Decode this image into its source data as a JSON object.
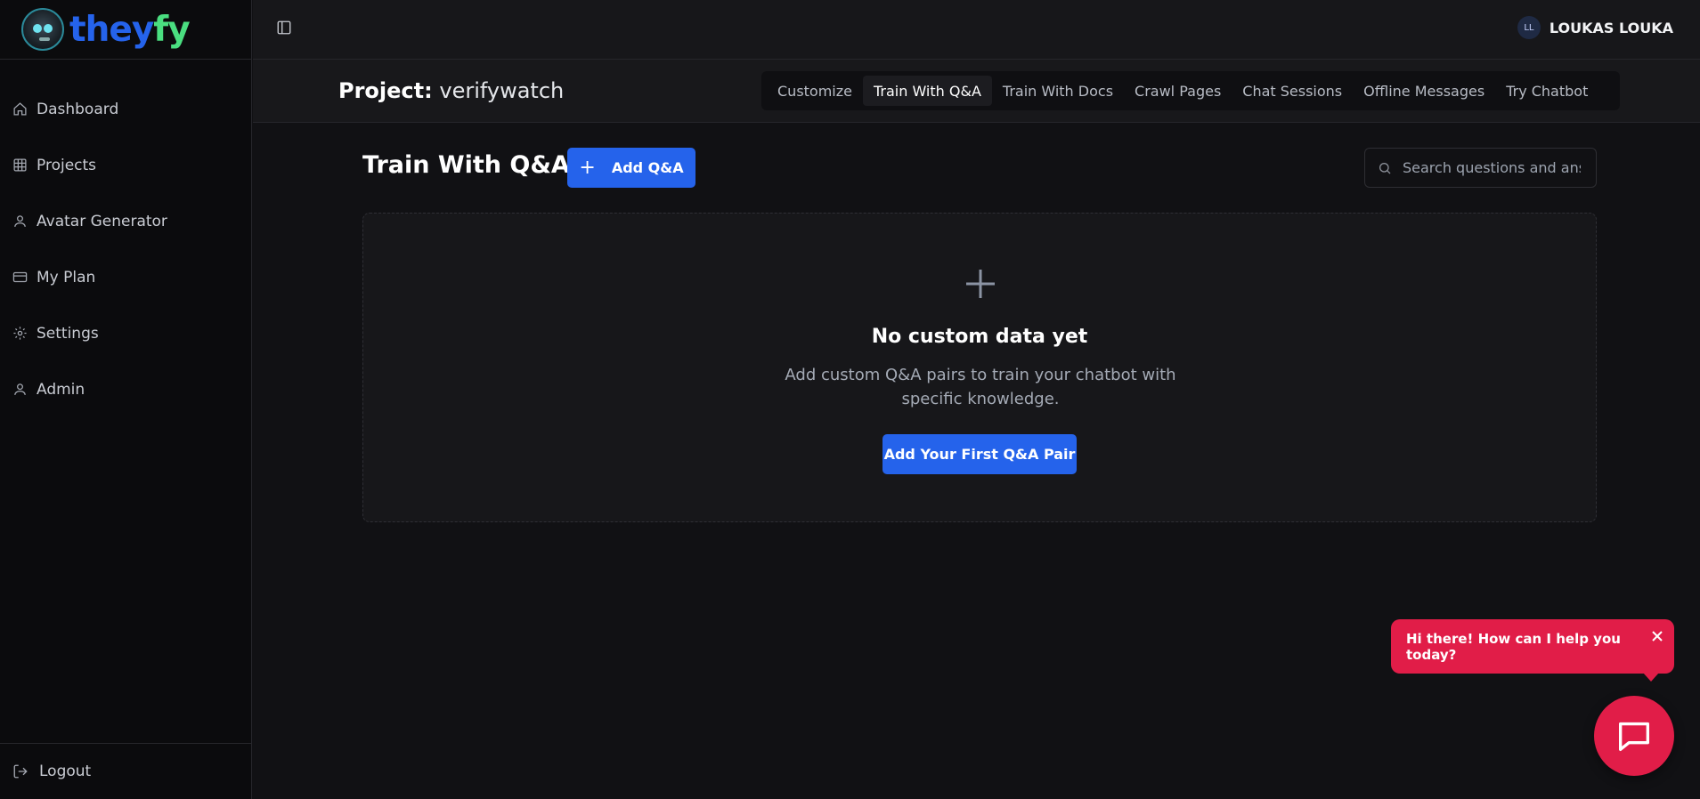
{
  "brand": {
    "name_part1": "they",
    "name_part2": "fy",
    "color1": "#2563eb",
    "color2": "#4ade80"
  },
  "sidebar": {
    "items": [
      {
        "label": "Dashboard",
        "icon": "home-icon"
      },
      {
        "label": "Projects",
        "icon": "grid-icon"
      },
      {
        "label": "Avatar Generator",
        "icon": "user-icon"
      },
      {
        "label": "My Plan",
        "icon": "credit-card-icon"
      },
      {
        "label": "Settings",
        "icon": "gear-icon"
      },
      {
        "label": "Admin",
        "icon": "user-icon"
      }
    ],
    "logout_label": "Logout"
  },
  "topbar": {
    "user_initials": "LL",
    "user_name": "LOUKAS LOUKA"
  },
  "project": {
    "prefix": "Project:",
    "name": "verifywatch"
  },
  "tabs": [
    {
      "label": "Customize",
      "active": false
    },
    {
      "label": "Train With Q&A",
      "active": true
    },
    {
      "label": "Train With Docs",
      "active": false
    },
    {
      "label": "Crawl Pages",
      "active": false
    },
    {
      "label": "Chat Sessions",
      "active": false
    },
    {
      "label": "Offline Messages",
      "active": false
    },
    {
      "label": "Try Chatbot",
      "active": false
    }
  ],
  "main": {
    "title": "Train With Q&A",
    "add_button": "Add Q&A",
    "search_placeholder": "Search questions and answers"
  },
  "empty_state": {
    "title": "No custom data yet",
    "description": "Add custom Q&A pairs to train your chatbot with specific knowledge.",
    "button": "Add Your First Q&A Pair"
  },
  "chat_widget": {
    "greeting": "Hi there! How can I help you today?",
    "accent": "#e11d48"
  }
}
